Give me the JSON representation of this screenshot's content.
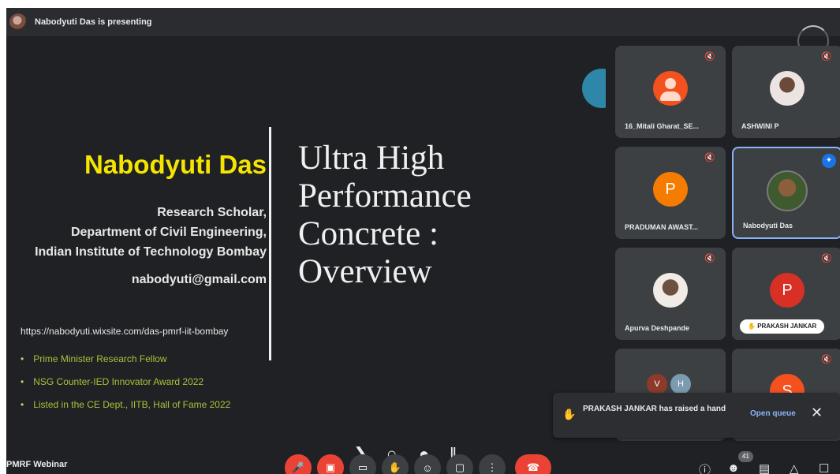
{
  "topbar": {
    "presenting_text": "Nabodyuti Das is presenting",
    "avatar_icon": "presenter-avatar"
  },
  "slide": {
    "name": "Nabodyuti Das",
    "role_lines": [
      "Research Scholar,",
      "Department of Civil Engineering,",
      "Indian Institute of Technology Bombay"
    ],
    "email": "nabodyuti@gmail.com",
    "url": "https://nabodyuti.wixsite.com/das-pmrf-iit-bombay",
    "title_lines": [
      "Ultra High",
      "Performance",
      "Concrete :",
      "Overview"
    ],
    "bullets": [
      "Prime Minister Research Fellow",
      "NSG Counter-IED Innovator Award 2022",
      "Listed in the CE Dept., IITB, Hall of Fame 2022"
    ],
    "colors": {
      "name": "#f5e400",
      "bullets": "#a6c23a"
    }
  },
  "participants": [
    {
      "name": "16_Mitali Gharat_SE...",
      "avatar": "person-icon",
      "letter": ""
    },
    {
      "name": "ASHWINI P",
      "avatar": "photo",
      "letter": ""
    },
    {
      "name": "PRADUMAN AWAST...",
      "avatar": "letter",
      "letter": "P"
    },
    {
      "name": "Nabodyuti Das",
      "avatar": "photo",
      "letter": ""
    },
    {
      "name": "Apurva Deshpande",
      "avatar": "photo",
      "letter": ""
    },
    {
      "name": "PRAKASH JANKAR",
      "avatar": "letter",
      "letter": "P",
      "hand_raised": true
    },
    {
      "name": "",
      "avatar": "group",
      "letters": [
        "V",
        "H"
      ]
    },
    {
      "name": "",
      "avatar": "letter",
      "letter": "S"
    }
  ],
  "notification": {
    "text": "PRAKASH JANKAR has raised a hand",
    "action": "Open queue",
    "icon": "hand-icon",
    "close_icon": "close-icon"
  },
  "bottombar": {
    "meeting_title": "PMRF Webinar",
    "participant_count": "41",
    "accent_red": "#ea4335",
    "accent_blue": "#8ab4f8"
  }
}
